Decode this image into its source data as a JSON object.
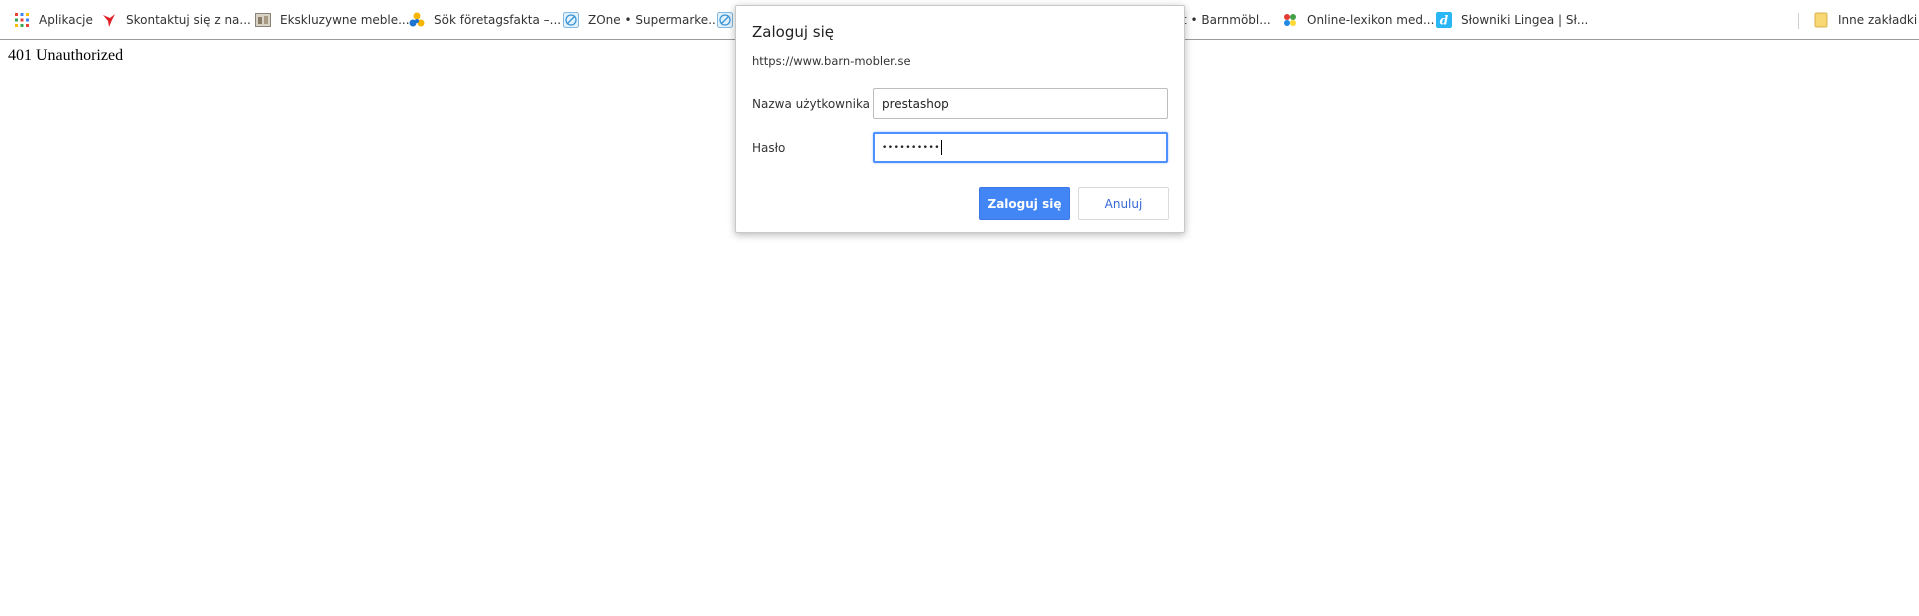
{
  "bookmarks": {
    "items": [
      {
        "label": "Aplikacje",
        "icon": "apps-grid-icon"
      },
      {
        "label": "Skontaktuj się z na...",
        "icon": "red-bird-icon"
      },
      {
        "label": "Ekskluzywne meble...",
        "icon": "furniture-thumbnail-icon"
      },
      {
        "label": "Sök företagsfakta –...",
        "icon": "colored-circles-icon"
      },
      {
        "label": "ZOne • Supermarke...",
        "icon": "zone-icon"
      },
      {
        "label": "kt • Barnmöbl...",
        "icon": ""
      },
      {
        "label": "Online-lexikon med...",
        "icon": "lexikon-icon"
      },
      {
        "label": "Słowniki Lingea | Sł...",
        "icon": "lingea-d-icon"
      }
    ],
    "other": {
      "label": "Inne zakładki",
      "icon": "folder-icon"
    }
  },
  "page": {
    "text": "401 Unauthorized"
  },
  "dialog": {
    "title": "Zaloguj się",
    "url": "https://www.barn-mobler.se",
    "username_label": "Nazwa użytkownika",
    "username_value": "prestashop",
    "password_label": "Hasło",
    "password_value": "••••••••••",
    "submit_label": "Zaloguj się",
    "cancel_label": "Anuluj"
  },
  "colors": {
    "primary_button": "#4285f4",
    "focus_border": "#4d90fe",
    "cancel_text": "#3367d6"
  }
}
